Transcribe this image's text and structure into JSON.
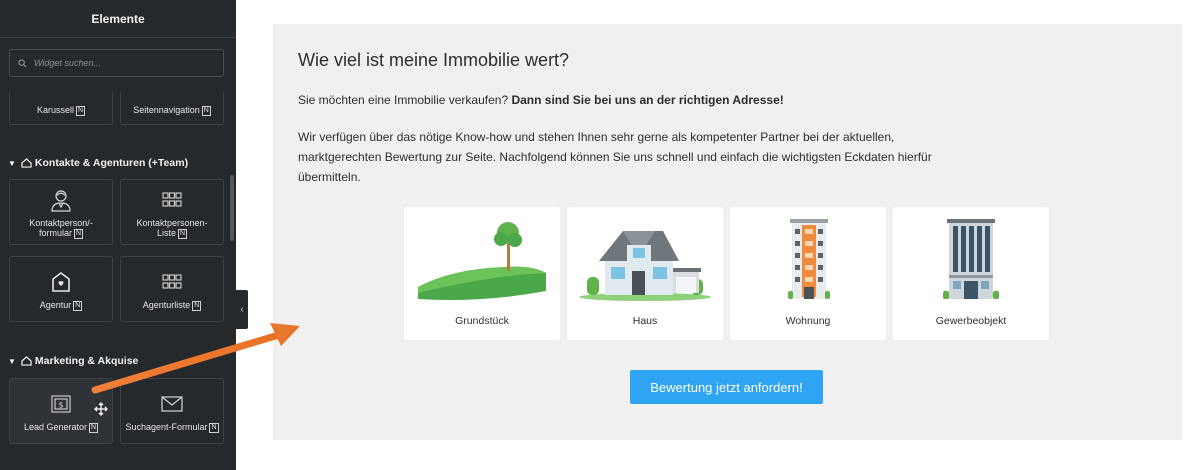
{
  "sidebar": {
    "title": "Elemente",
    "search_placeholder": "Widget suchen...",
    "badge": "N",
    "top_widgets": [
      {
        "label": "Karussell",
        "icon": "carousel-icon"
      },
      {
        "label": "Seitennavigation",
        "icon": "page-navigation-icon"
      }
    ],
    "sections": [
      {
        "title": "Kontakte & Agenturen (+Team)",
        "icon": "house-outline-icon",
        "widgets": [
          {
            "label_line1": "Kontaktperson/-",
            "label_line2": "formular",
            "icon": "contact-person-icon"
          },
          {
            "label_line1": "Kontaktpersonen-",
            "label_line2": "Liste",
            "icon": "grid-icon"
          },
          {
            "label_line1": "Agentur",
            "icon": "agency-house-icon"
          },
          {
            "label_line1": "Agenturliste",
            "icon": "grid-icon"
          }
        ]
      },
      {
        "title": "Marketing & Akquise",
        "icon": "house-outline-icon",
        "widgets": [
          {
            "label_line1": "Lead Generator",
            "icon": "lead-generator-icon"
          },
          {
            "label_line1": "Suchagent-Formular",
            "icon": "envelope-icon"
          }
        ]
      }
    ]
  },
  "main": {
    "heading": "Wie viel ist meine Immobilie wert?",
    "intro_plain": "Sie möchten eine Immobilie verkaufen? ",
    "intro_bold": "Dann sind Sie bei uns an der richtigen Adresse!",
    "paragraph_line1": "Wir verfügen über das nötige Know-how und stehen Ihnen sehr gerne als kompetenter Partner bei der aktuellen,",
    "paragraph_line2": "marktgerechten Bewertung zur Seite. Nachfolgend können Sie uns schnell und einfach die wichtigsten Eckdaten hierfür",
    "paragraph_line3": "übermitteln.",
    "property_types": [
      {
        "label": "Grundstück",
        "icon": "land-plot-illustration"
      },
      {
        "label": "Haus",
        "icon": "house-illustration"
      },
      {
        "label": "Wohnung",
        "icon": "apartment-building-illustration"
      },
      {
        "label": "Gewerbeobjekt",
        "icon": "office-building-illustration"
      }
    ],
    "cta_label": "Bewertung jetzt anfordern!"
  },
  "colors": {
    "sidebar_bg": "#26292c",
    "panel_bg": "#f0f0f1",
    "cta": "#2fa4f2",
    "arrow": "#e8772e"
  }
}
